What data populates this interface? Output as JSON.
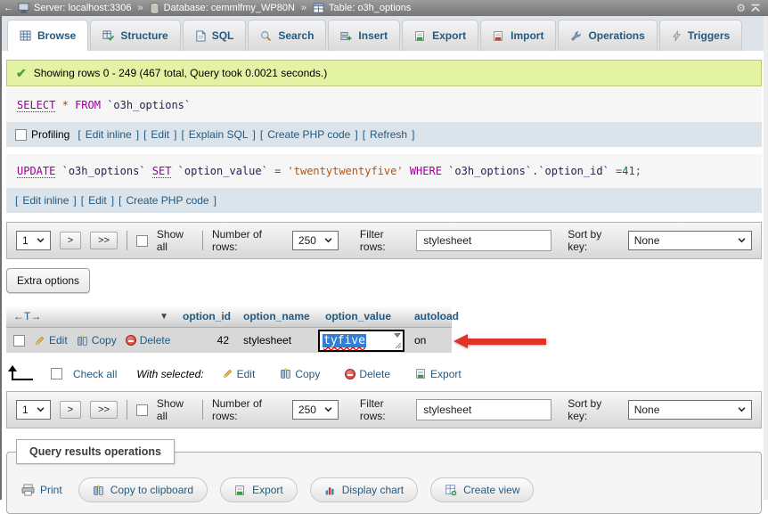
{
  "punct": {
    "open": "[",
    "close": "]"
  },
  "topbar": {
    "back": "←",
    "server": "Server: localhost:3306",
    "sep": "»",
    "database": "Database: cemmlfmy_WP80N",
    "table": "Table: o3h_options",
    "gear": "⚙"
  },
  "tabs": [
    {
      "label": "Browse"
    },
    {
      "label": "Structure"
    },
    {
      "label": "SQL"
    },
    {
      "label": "Search"
    },
    {
      "label": "Insert"
    },
    {
      "label": "Export"
    },
    {
      "label": "Import"
    },
    {
      "label": "Operations"
    },
    {
      "label": "Triggers"
    }
  ],
  "message": {
    "check": "✔",
    "text": "Showing rows 0 - 249 (467 total, Query took 0.0021 seconds.)"
  },
  "sql1": {
    "k_select": "SELECT",
    "star": "*",
    "k_from": "FROM",
    "id_table": "`o3h_options`"
  },
  "profiling": {
    "label": "Profiling",
    "links": [
      "Edit inline",
      "Edit",
      "Explain SQL",
      "Create PHP code",
      "Refresh"
    ]
  },
  "sql2": {
    "k_update": "UPDATE",
    "id_table": "`o3h_options`",
    "k_set": "SET",
    "id_col": "`option_value`",
    "eq": "=",
    "str_val": "'twentytwentyfive'",
    "k_where": "WHERE",
    "id_ref": "`o3h_options`.`option_id`",
    "eq2": "=",
    "num": "41",
    "semi": ";"
  },
  "sql2_links": [
    "Edit inline",
    "Edit",
    "Create PHP code"
  ],
  "pagination": {
    "page": "1",
    "next": ">",
    "last": ">>",
    "show_all": "Show all",
    "num_rows_label": "Number of rows:",
    "num_rows_value": "250",
    "filter_label": "Filter rows:",
    "filter_value": "stylesheet",
    "sort_label": "Sort by key:",
    "sort_value": "None"
  },
  "extra_options_label": "Extra options",
  "table": {
    "nav_glyph": "←T→",
    "sort_glyph": "▼",
    "columns": [
      "option_id",
      "option_name",
      "option_value",
      "autoload"
    ],
    "row": {
      "edit": "Edit",
      "copy": "Copy",
      "delete": "Delete",
      "option_id": "42",
      "option_name": "stylesheet",
      "value_text": "tyfive",
      "autoload": "on"
    }
  },
  "with_selected": {
    "check_all": "Check all",
    "label": "With selected:",
    "edit": "Edit",
    "copy": "Copy",
    "delete": "Delete",
    "export": "Export"
  },
  "operations": {
    "legend": "Query results operations",
    "print": "Print",
    "copy": "Copy to clipboard",
    "export": "Export",
    "chart": "Display chart",
    "view": "Create view"
  },
  "colors": {
    "accent": "#235a81",
    "success_bg": "#e4f2a4",
    "keyword": "#990099",
    "string": "#b5540f",
    "number": "#116644",
    "selection_blue": "#2e7fd8",
    "arrow_red": "#e0342b"
  }
}
